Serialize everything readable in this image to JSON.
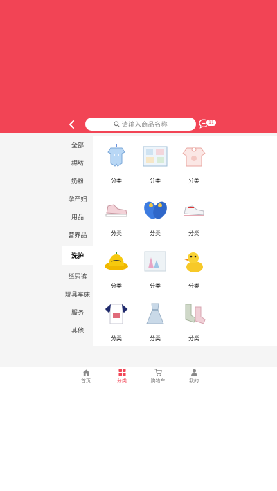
{
  "header": {
    "search_placeholder": "请输入商品名称",
    "message_badge": "11",
    "accent_color": "#f24455",
    "icons": {
      "back": "chevron-left-icon",
      "search": "search-icon",
      "message": "message-icon"
    }
  },
  "sidebar": {
    "items": [
      {
        "label": "全部"
      },
      {
        "label": "棉纺"
      },
      {
        "label": "奶粉"
      },
      {
        "label": "孕产妇"
      },
      {
        "label": "用品"
      },
      {
        "label": "营养品"
      },
      {
        "label": "洗护",
        "active": true
      },
      {
        "label": "纸尿裤"
      },
      {
        "label": "玩具车床"
      },
      {
        "label": "服务"
      },
      {
        "label": "其他"
      }
    ]
  },
  "categories": [
    {
      "label": "分类",
      "icon": "baby-romper-icon"
    },
    {
      "label": "分类",
      "icon": "gift-box-icon"
    },
    {
      "label": "分类",
      "icon": "baby-bib-icon"
    },
    {
      "label": "分类",
      "icon": "sneaker-icon"
    },
    {
      "label": "分类",
      "icon": "sandal-icon"
    },
    {
      "label": "分类",
      "icon": "baby-shoe-icon"
    },
    {
      "label": "分类",
      "icon": "sun-hat-icon"
    },
    {
      "label": "分类",
      "icon": "towel-icon"
    },
    {
      "label": "分类",
      "icon": "duck-toy-icon"
    },
    {
      "label": "分类",
      "icon": "tshirt-icon"
    },
    {
      "label": "分类",
      "icon": "dress-icon"
    },
    {
      "label": "分类",
      "icon": "socks-icon"
    }
  ],
  "bottom_nav": {
    "items": [
      {
        "label": "首页",
        "icon": "home-icon"
      },
      {
        "label": "分类",
        "icon": "category-icon",
        "active": true
      },
      {
        "label": "购物车",
        "icon": "cart-icon"
      },
      {
        "label": "我的",
        "icon": "user-icon"
      }
    ]
  }
}
